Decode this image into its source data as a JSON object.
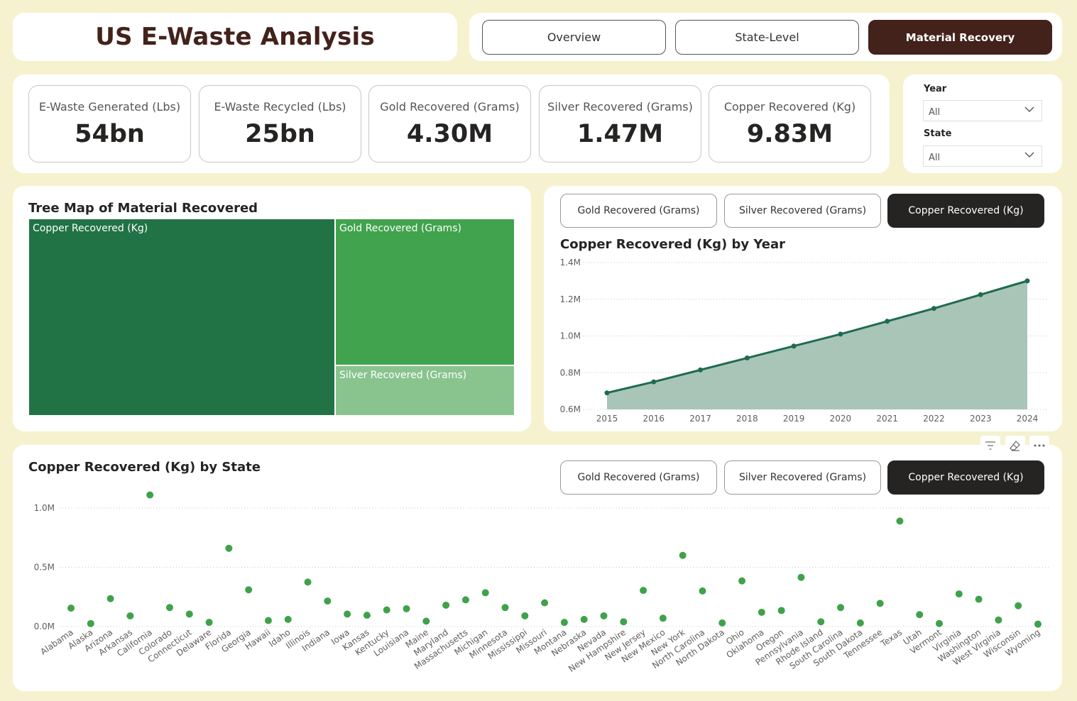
{
  "header": {
    "title": "US E-Waste Analysis"
  },
  "nav": [
    "Overview",
    "State-Level",
    "Material Recovery"
  ],
  "nav_active": 2,
  "kpis": [
    {
      "label": "E-Waste Generated (Lbs)",
      "value": "54bn"
    },
    {
      "label": "E-Waste Recycled (Lbs)",
      "value": "25bn"
    },
    {
      "label": "Gold Recovered (Grams)",
      "value": "4.30M"
    },
    {
      "label": "Silver Recovered (Grams)",
      "value": "1.47M"
    },
    {
      "label": "Copper Recovered (Kg)",
      "value": "9.83M"
    }
  ],
  "filters": {
    "year_label": "Year",
    "year_value": "All",
    "state_label": "State",
    "state_value": "All"
  },
  "treemap": {
    "title": "Tree Map of Material Recovered",
    "items": [
      {
        "label": "Copper Recovered (Kg)",
        "color": "#217346"
      },
      {
        "label": "Gold Recovered (Grams)",
        "color": "#41a34d"
      },
      {
        "label": "Silver Recovered (Grams)",
        "color": "#89c48f"
      }
    ]
  },
  "metric_buttons": [
    "Gold Recovered (Grams)",
    "Silver Recovered (Grams)",
    "Copper Recovered (Kg)"
  ],
  "metric_active": 2,
  "colors": {
    "line": "#1f6b4f",
    "area": "#a8c5b8",
    "dot": "#3fa24b",
    "accent": "#42221a"
  },
  "chart_data": [
    {
      "type": "area",
      "title": "Copper Recovered (Kg) by Year",
      "x": [
        "2015",
        "2016",
        "2017",
        "2018",
        "2019",
        "2020",
        "2021",
        "2022",
        "2023",
        "2024"
      ],
      "values": [
        690000,
        750000,
        815000,
        880000,
        945000,
        1010000,
        1080000,
        1150000,
        1225000,
        1300000
      ],
      "y_ticks": [
        "0.6M",
        "0.8M",
        "1.0M",
        "1.2M",
        "1.4M"
      ],
      "ylim": [
        600000,
        1400000
      ],
      "grid": true
    },
    {
      "type": "scatter",
      "title": "Copper Recovered (Kg) by State",
      "x": [
        "Alabama",
        "Alaska",
        "Arizona",
        "Arkansas",
        "California",
        "Colorado",
        "Connecticut",
        "Delaware",
        "Florida",
        "Georgia",
        "Hawaii",
        "Idaho",
        "Illinois",
        "Indiana",
        "Iowa",
        "Kansas",
        "Kentucky",
        "Louisiana",
        "Maine",
        "Maryland",
        "Massachusetts",
        "Michigan",
        "Minnesota",
        "Mississippi",
        "Missouri",
        "Montana",
        "Nebraska",
        "Nevada",
        "New Hampshire",
        "New Jersey",
        "New Mexico",
        "New York",
        "North Carolina",
        "North Dakota",
        "Ohio",
        "Oklahoma",
        "Oregon",
        "Pennsylvania",
        "Rhode Island",
        "South Carolina",
        "South Dakota",
        "Tennessee",
        "Texas",
        "Utah",
        "Vermont",
        "Virginia",
        "Washington",
        "West Virginia",
        "Wisconsin",
        "Wyoming"
      ],
      "values": [
        155000,
        25000,
        235000,
        90000,
        1110000,
        160000,
        105000,
        35000,
        660000,
        310000,
        50000,
        60000,
        375000,
        215000,
        105000,
        95000,
        140000,
        150000,
        45000,
        180000,
        225000,
        285000,
        160000,
        90000,
        200000,
        35000,
        60000,
        90000,
        40000,
        305000,
        70000,
        600000,
        300000,
        30000,
        385000,
        120000,
        135000,
        415000,
        40000,
        160000,
        30000,
        195000,
        890000,
        100000,
        25000,
        275000,
        230000,
        55000,
        175000,
        20000
      ],
      "y_ticks": [
        "0.0M",
        "0.5M",
        "1.0M"
      ],
      "ylim": [
        0,
        1000000
      ],
      "grid": true
    }
  ]
}
